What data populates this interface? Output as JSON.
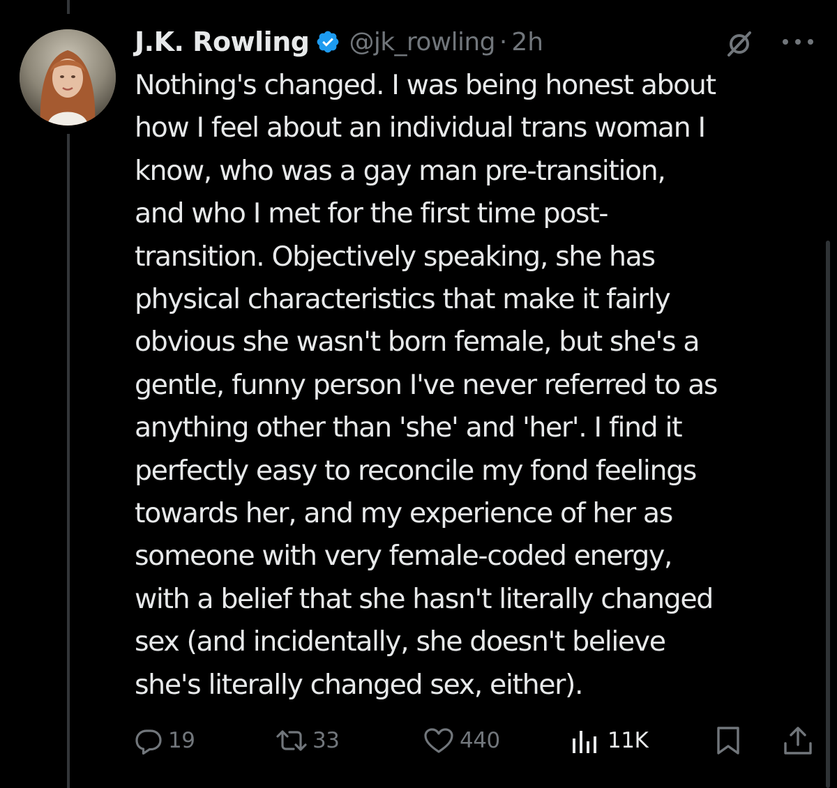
{
  "tweet": {
    "author": {
      "display_name": "J.K. Rowling",
      "handle": "@jk_rowling",
      "verified": true,
      "avatar_icon": "author-avatar-photo"
    },
    "separator": "·",
    "timestamp": "2h",
    "text_lines": [
      "Nothing's changed. I was being honest about",
      "how I feel about an individual trans woman I",
      "know, who was a gay man pre-transition,",
      "and who I met for the first time post-",
      "transition. Objectively speaking, she has",
      "physical characteristics that make it fairly",
      "obvious she wasn't born female, but she's a",
      "gentle, funny person I've never referred to as",
      "anything other than 'she' and 'her'. I find it",
      "perfectly easy to reconcile my fond feelings",
      "towards her, and my experience of her as",
      "someone with very female-coded energy,",
      "with a belief that she hasn't literally changed",
      "sex (and incidentally, she doesn't believe",
      "she's literally changed sex, either)."
    ],
    "metrics": {
      "replies": "19",
      "reposts": "33",
      "likes": "440",
      "views": "11K"
    }
  },
  "icons": {
    "verified": "verified-badge-icon",
    "grok": "grok-icon",
    "more": "more-options-icon",
    "reply": "reply-icon",
    "repost": "repost-icon",
    "like": "like-heart-icon",
    "views": "views-chart-icon",
    "bookmark": "bookmark-icon",
    "share": "share-icon"
  },
  "colors": {
    "background": "#000000",
    "text_primary": "#e7e9ea",
    "text_secondary": "#71767b",
    "verified_blue": "#1d9bf0",
    "thread_line": "#333639"
  }
}
